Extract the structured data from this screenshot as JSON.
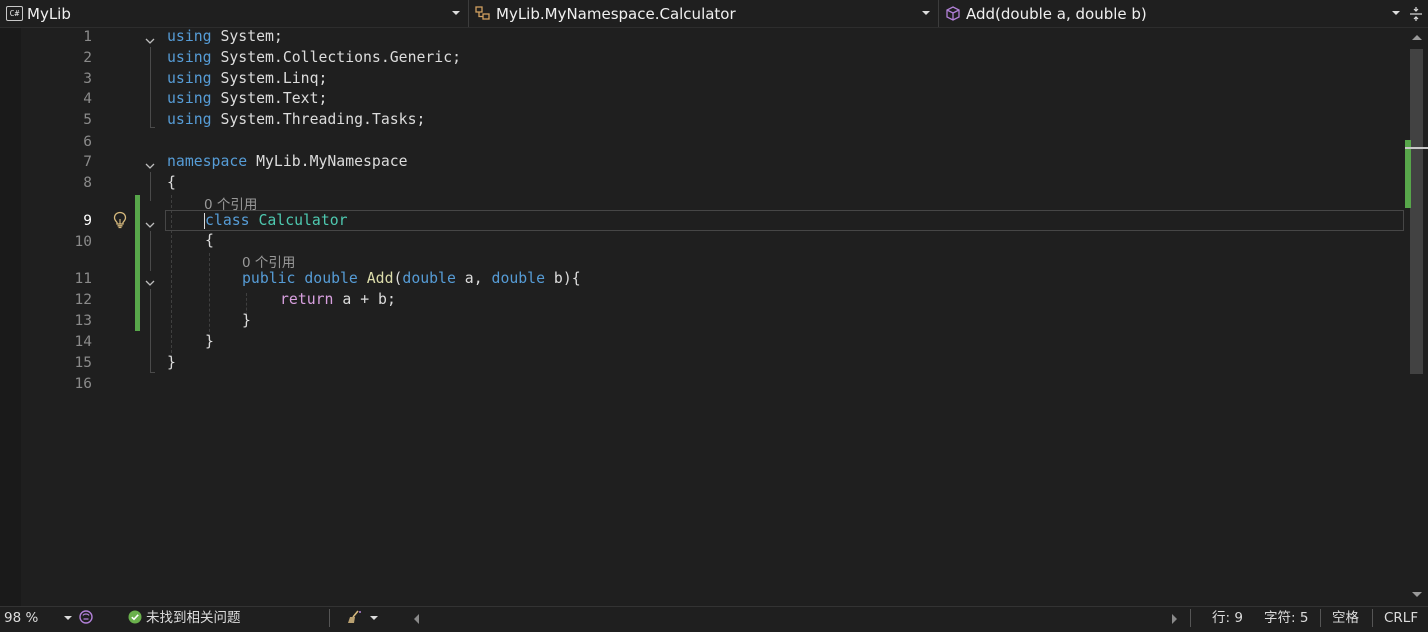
{
  "navbar": {
    "project": {
      "label": "MyLib",
      "icon": "csharp-project-icon",
      "badge": "C#"
    },
    "type": {
      "label": "MyLib.MyNamespace.Calculator",
      "icon": "class-icon"
    },
    "member": {
      "label": "Add(double a, double b)",
      "icon": "method-cube-icon"
    }
  },
  "editor": {
    "line_numbers": [
      "1",
      "2",
      "3",
      "4",
      "5",
      "6",
      "7",
      "8",
      "9",
      "10",
      "11",
      "12",
      "13",
      "14",
      "15",
      "16"
    ],
    "active_line": "9",
    "codelens": {
      "class_refs": "0 个引用",
      "method_refs": "0 个引用"
    },
    "code": {
      "using": "using",
      "sys": "System",
      "collections": "Collections",
      "generic": "Generic",
      "linq": "Linq",
      "text": "Text",
      "threading": "Threading",
      "tasks": "Tasks",
      "namespace_kw": "namespace",
      "ns_mylib": "MyLib",
      "ns_myns": "MyNamespace",
      "class_kw": "class",
      "class_name": "Calculator",
      "public_kw": "public",
      "double_kw": "double",
      "method_name": "Add",
      "param_a": "a",
      "param_b": "b",
      "return_kw": "return",
      "open_brace": "{",
      "close_brace": "}"
    }
  },
  "colors": {
    "keyword": "#569cd6",
    "control_keyword": "#d8a0df",
    "type": "#4ec9b0",
    "method": "#dcdcaa",
    "change_bar": "#57a64a"
  },
  "statusbar": {
    "zoom": "98 %",
    "issues": "未找到相关问题",
    "line": "行: 9",
    "char": "字符: 5",
    "whitespace": "空格",
    "line_ending": "CRLF"
  }
}
